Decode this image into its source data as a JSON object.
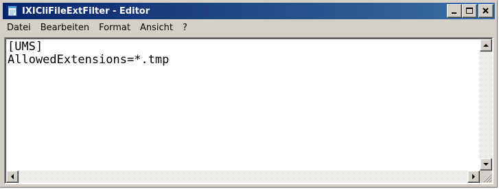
{
  "window": {
    "title": "IXICliFileExtFilter - Editor"
  },
  "menu": {
    "items": [
      "Datei",
      "Bearbeiten",
      "Format",
      "Ansicht",
      "?"
    ]
  },
  "editor": {
    "lines": [
      "[UMS]",
      "AllowedExtensions=*.tmp"
    ]
  },
  "icons": {
    "app": "notepad-icon",
    "minimize": "minimize-icon",
    "maximize": "maximize-icon",
    "close": "close-icon",
    "scroll_up": "arrow-up-icon",
    "scroll_down": "arrow-down-icon",
    "scroll_left": "arrow-left-icon",
    "scroll_right": "arrow-right-icon",
    "size_grip": "size-grip-icon"
  },
  "colors": {
    "titlebar_start": "#0a246a",
    "titlebar_end": "#3a6ea5",
    "chrome": "#d4d0c8",
    "editor_background": "#ffffff"
  }
}
